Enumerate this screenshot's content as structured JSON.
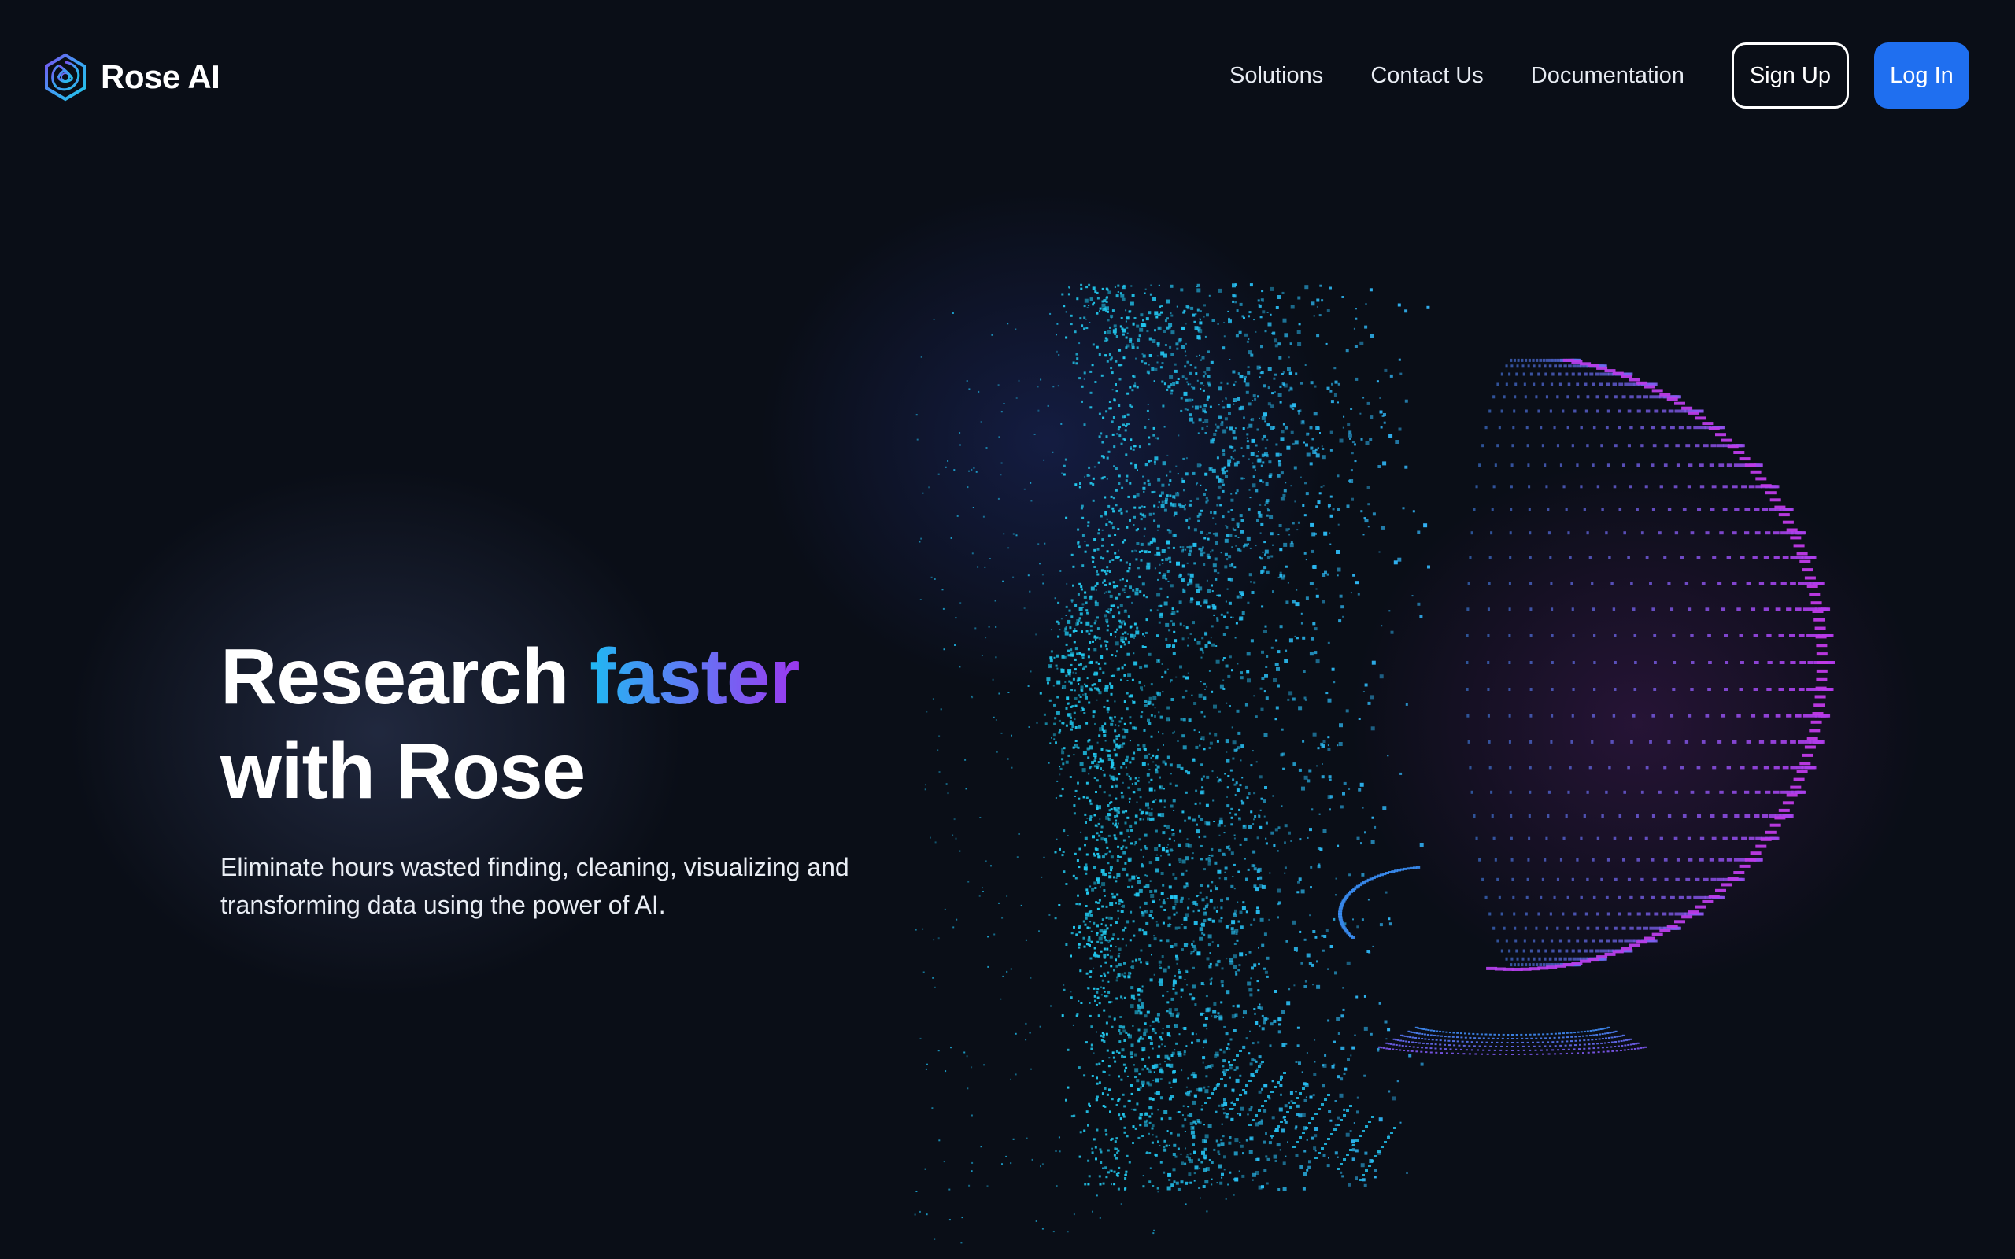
{
  "brand": {
    "name": "Rose AI",
    "logo_icon": "hexagon-swirl-icon"
  },
  "nav": {
    "links": [
      {
        "label": "Solutions"
      },
      {
        "label": "Contact Us"
      },
      {
        "label": "Documentation"
      }
    ],
    "signup_label": "Sign Up",
    "login_label": "Log In"
  },
  "hero": {
    "title_prefix": "Research ",
    "title_accent": "faster",
    "title_suffix": "with Rose",
    "subtitle": "Eliminate hours wasted finding, cleaning, visualizing and transforming data using the power of AI."
  },
  "colors": {
    "background": "#0a0e17",
    "accent_blue": "#1f6ff0",
    "gradient_cyan": "#1fb8f2",
    "gradient_purple": "#9b38ef"
  },
  "visual": {
    "description_icon": "particle-face-sphere-illustration"
  }
}
